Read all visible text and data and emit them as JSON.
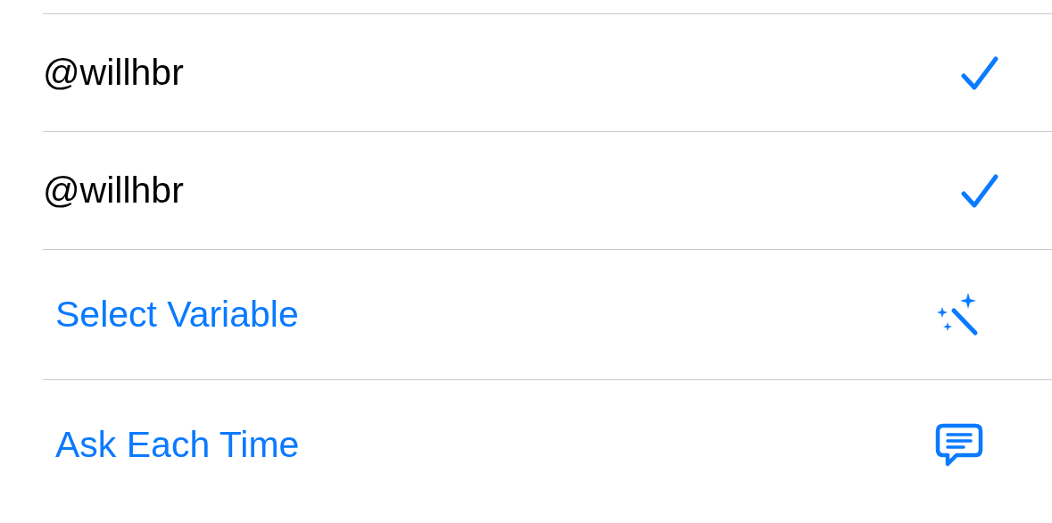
{
  "rows": [
    {
      "kind": "option",
      "label": "@willhbr",
      "selected": true
    },
    {
      "kind": "option",
      "label": "@willhbr",
      "selected": true
    },
    {
      "kind": "variable",
      "label": "Select Variable"
    },
    {
      "kind": "ask",
      "label": "Ask Each Time"
    }
  ]
}
